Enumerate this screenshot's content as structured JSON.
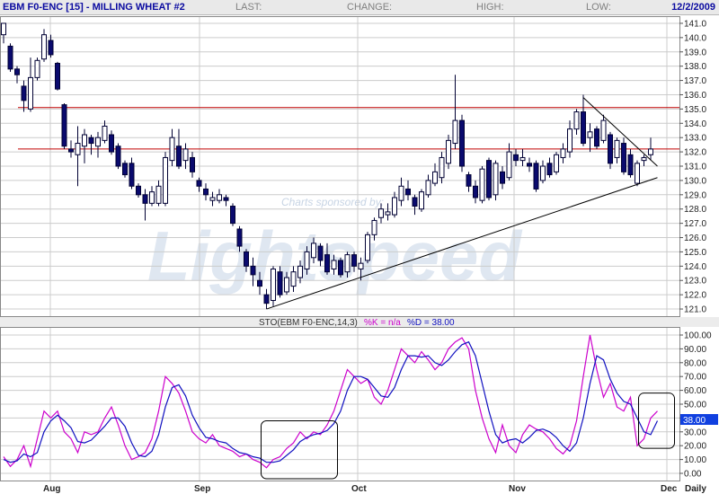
{
  "header": {
    "title": "EBM F0-ENC [15] - MILLING WHEAT #2",
    "last_label": "LAST:",
    "change_label": "CHANGE:",
    "high_label": "HIGH:",
    "low_label": "LOW:",
    "date": "12/2/2009"
  },
  "watermark": {
    "sponsor_text": "Charts sponsored by:",
    "logo_text": "Lightspeed"
  },
  "colors": {
    "up_candle_fill": "#ffffff",
    "down_candle_fill": "#0a0a6e",
    "candle_outline": "#000033",
    "resistance_line": "#c00000",
    "trend_line": "#000000",
    "k_line": "#cc00cc",
    "d_line": "#1010c0",
    "last_value_box": "#1040e0",
    "grid": "#cccccc"
  },
  "chart_data": [
    {
      "type": "candlestick",
      "y_ticks": [
        "141.0",
        "140.0",
        "139.0",
        "138.0",
        "137.0",
        "136.0",
        "135.0",
        "134.0",
        "133.0",
        "132.0",
        "131.0",
        "130.0",
        "129.0",
        "128.0",
        "127.0",
        "126.0",
        "125.0",
        "124.0",
        "123.0",
        "122.0",
        "121.0"
      ],
      "ylim": [
        120.5,
        141.5
      ],
      "grid": true,
      "x_labels": [
        "Aug",
        "Sep",
        "Oct",
        "Nov",
        "Dec",
        "Daily"
      ],
      "candles": [
        {
          "o": 140.2,
          "h": 140.8,
          "l": 139.6,
          "c": 141.0
        },
        {
          "o": 139.4,
          "h": 139.6,
          "l": 137.6,
          "c": 137.8
        },
        {
          "o": 137.8,
          "h": 138.0,
          "l": 136.8,
          "c": 137.4
        },
        {
          "o": 136.6,
          "h": 137.0,
          "l": 134.8,
          "c": 135.6
        },
        {
          "o": 135.0,
          "h": 138.6,
          "l": 134.8,
          "c": 137.2
        },
        {
          "o": 137.2,
          "h": 138.6,
          "l": 137.0,
          "c": 138.4
        },
        {
          "o": 138.5,
          "h": 140.6,
          "l": 138.3,
          "c": 140.2
        },
        {
          "o": 139.8,
          "h": 140.2,
          "l": 138.6,
          "c": 138.8
        },
        {
          "o": 138.2,
          "h": 138.3,
          "l": 136.3,
          "c": 136.4
        },
        {
          "o": 135.3,
          "h": 135.4,
          "l": 132.2,
          "c": 132.4
        },
        {
          "o": 132.2,
          "h": 132.8,
          "l": 131.6,
          "c": 132.0
        },
        {
          "o": 131.8,
          "h": 133.8,
          "l": 129.6,
          "c": 132.6
        },
        {
          "o": 132.4,
          "h": 133.6,
          "l": 131.2,
          "c": 133.2
        },
        {
          "o": 133.0,
          "h": 133.2,
          "l": 131.8,
          "c": 132.6
        },
        {
          "o": 132.4,
          "h": 133.4,
          "l": 131.6,
          "c": 133.0
        },
        {
          "o": 132.8,
          "h": 134.2,
          "l": 132.6,
          "c": 133.8
        },
        {
          "o": 133.2,
          "h": 133.5,
          "l": 131.8,
          "c": 132.0
        },
        {
          "o": 132.4,
          "h": 132.6,
          "l": 130.8,
          "c": 131.0
        },
        {
          "o": 131.2,
          "h": 131.4,
          "l": 130.2,
          "c": 130.4
        },
        {
          "o": 131.2,
          "h": 131.6,
          "l": 129.4,
          "c": 129.6
        },
        {
          "o": 129.6,
          "h": 129.8,
          "l": 128.8,
          "c": 129.0
        },
        {
          "o": 129.0,
          "h": 129.4,
          "l": 127.2,
          "c": 128.4
        },
        {
          "o": 128.4,
          "h": 129.6,
          "l": 128.2,
          "c": 129.2
        },
        {
          "o": 128.4,
          "h": 130.0,
          "l": 128.2,
          "c": 129.6
        },
        {
          "o": 128.4,
          "h": 132.0,
          "l": 128.2,
          "c": 131.6
        },
        {
          "o": 131.4,
          "h": 133.6,
          "l": 131.0,
          "c": 133.0
        },
        {
          "o": 132.4,
          "h": 133.6,
          "l": 130.8,
          "c": 131.0
        },
        {
          "o": 131.4,
          "h": 132.6,
          "l": 130.8,
          "c": 132.2
        },
        {
          "o": 131.6,
          "h": 132.0,
          "l": 130.2,
          "c": 130.6
        },
        {
          "o": 130.0,
          "h": 130.2,
          "l": 129.2,
          "c": 129.6
        },
        {
          "o": 129.4,
          "h": 129.8,
          "l": 128.6,
          "c": 129.0
        },
        {
          "o": 128.6,
          "h": 129.2,
          "l": 128.2,
          "c": 128.8
        },
        {
          "o": 128.6,
          "h": 129.4,
          "l": 128.4,
          "c": 129.0
        },
        {
          "o": 128.8,
          "h": 129.0,
          "l": 128.2,
          "c": 128.6
        },
        {
          "o": 128.2,
          "h": 128.4,
          "l": 126.8,
          "c": 127.0
        },
        {
          "o": 126.6,
          "h": 126.8,
          "l": 125.0,
          "c": 125.4
        },
        {
          "o": 125.0,
          "h": 125.2,
          "l": 123.6,
          "c": 124.0
        },
        {
          "o": 124.0,
          "h": 124.6,
          "l": 122.6,
          "c": 123.4
        },
        {
          "o": 123.0,
          "h": 123.6,
          "l": 122.0,
          "c": 122.6
        },
        {
          "o": 122.0,
          "h": 122.4,
          "l": 121.0,
          "c": 121.4
        },
        {
          "o": 121.6,
          "h": 124.0,
          "l": 121.2,
          "c": 123.8
        },
        {
          "o": 123.6,
          "h": 124.0,
          "l": 121.8,
          "c": 122.0
        },
        {
          "o": 122.2,
          "h": 123.6,
          "l": 122.0,
          "c": 123.2
        },
        {
          "o": 122.6,
          "h": 124.0,
          "l": 122.2,
          "c": 123.6
        },
        {
          "o": 123.2,
          "h": 124.4,
          "l": 122.8,
          "c": 124.0
        },
        {
          "o": 123.8,
          "h": 125.4,
          "l": 123.4,
          "c": 125.0
        },
        {
          "o": 124.6,
          "h": 126.0,
          "l": 124.2,
          "c": 125.6
        },
        {
          "o": 125.4,
          "h": 125.6,
          "l": 124.0,
          "c": 124.4
        },
        {
          "o": 124.8,
          "h": 125.6,
          "l": 123.4,
          "c": 123.6
        },
        {
          "o": 123.8,
          "h": 124.8,
          "l": 123.4,
          "c": 124.4
        },
        {
          "o": 124.4,
          "h": 124.6,
          "l": 123.2,
          "c": 123.4
        },
        {
          "o": 123.6,
          "h": 125.0,
          "l": 123.2,
          "c": 124.8
        },
        {
          "o": 124.8,
          "h": 125.0,
          "l": 123.6,
          "c": 124.0
        },
        {
          "o": 123.8,
          "h": 124.6,
          "l": 123.0,
          "c": 124.2
        },
        {
          "o": 124.4,
          "h": 126.4,
          "l": 124.2,
          "c": 126.2
        },
        {
          "o": 126.2,
          "h": 127.4,
          "l": 125.8,
          "c": 127.2
        },
        {
          "o": 127.4,
          "h": 128.4,
          "l": 127.0,
          "c": 128.0
        },
        {
          "o": 127.6,
          "h": 128.4,
          "l": 127.2,
          "c": 127.8
        },
        {
          "o": 127.6,
          "h": 129.2,
          "l": 127.4,
          "c": 128.8
        },
        {
          "o": 128.6,
          "h": 130.2,
          "l": 128.2,
          "c": 129.6
        },
        {
          "o": 129.4,
          "h": 130.0,
          "l": 128.6,
          "c": 129.0
        },
        {
          "o": 128.8,
          "h": 129.0,
          "l": 127.6,
          "c": 128.2
        },
        {
          "o": 128.0,
          "h": 129.4,
          "l": 127.8,
          "c": 129.2
        },
        {
          "o": 129.0,
          "h": 130.4,
          "l": 128.8,
          "c": 130.0
        },
        {
          "o": 129.8,
          "h": 131.2,
          "l": 129.6,
          "c": 130.6
        },
        {
          "o": 130.2,
          "h": 132.0,
          "l": 129.8,
          "c": 131.6
        },
        {
          "o": 131.2,
          "h": 133.2,
          "l": 130.8,
          "c": 132.8
        },
        {
          "o": 132.6,
          "h": 137.4,
          "l": 132.2,
          "c": 134.2
        },
        {
          "o": 134.2,
          "h": 134.6,
          "l": 130.6,
          "c": 131.0
        },
        {
          "o": 130.4,
          "h": 130.6,
          "l": 129.2,
          "c": 129.6
        },
        {
          "o": 129.6,
          "h": 130.0,
          "l": 128.4,
          "c": 128.8
        },
        {
          "o": 128.6,
          "h": 131.0,
          "l": 128.4,
          "c": 130.8
        },
        {
          "o": 131.4,
          "h": 131.6,
          "l": 128.6,
          "c": 128.8
        },
        {
          "o": 129.0,
          "h": 131.4,
          "l": 128.6,
          "c": 131.2
        },
        {
          "o": 130.6,
          "h": 131.0,
          "l": 129.4,
          "c": 129.8
        },
        {
          "o": 130.2,
          "h": 132.6,
          "l": 130.0,
          "c": 132.0
        },
        {
          "o": 131.8,
          "h": 132.2,
          "l": 131.0,
          "c": 131.4
        },
        {
          "o": 131.4,
          "h": 132.2,
          "l": 131.0,
          "c": 131.6
        },
        {
          "o": 131.2,
          "h": 131.6,
          "l": 130.6,
          "c": 131.0
        },
        {
          "o": 131.2,
          "h": 131.4,
          "l": 129.2,
          "c": 129.4
        },
        {
          "o": 130.0,
          "h": 131.4,
          "l": 129.8,
          "c": 131.0
        },
        {
          "o": 131.2,
          "h": 131.6,
          "l": 130.2,
          "c": 130.4
        },
        {
          "o": 130.6,
          "h": 132.0,
          "l": 130.4,
          "c": 131.8
        },
        {
          "o": 131.6,
          "h": 132.6,
          "l": 131.2,
          "c": 132.2
        },
        {
          "o": 132.0,
          "h": 134.2,
          "l": 131.6,
          "c": 133.6
        },
        {
          "o": 133.6,
          "h": 135.0,
          "l": 133.2,
          "c": 134.8
        },
        {
          "o": 134.8,
          "h": 136.0,
          "l": 132.4,
          "c": 132.6
        },
        {
          "o": 133.0,
          "h": 134.0,
          "l": 132.0,
          "c": 133.4
        },
        {
          "o": 133.6,
          "h": 133.8,
          "l": 132.2,
          "c": 132.4
        },
        {
          "o": 132.8,
          "h": 134.6,
          "l": 132.6,
          "c": 134.2
        },
        {
          "o": 133.2,
          "h": 133.4,
          "l": 130.8,
          "c": 131.2
        },
        {
          "o": 131.6,
          "h": 133.0,
          "l": 131.2,
          "c": 132.8
        },
        {
          "o": 132.6,
          "h": 133.0,
          "l": 130.4,
          "c": 130.6
        },
        {
          "o": 131.8,
          "h": 132.2,
          "l": 130.2,
          "c": 130.4
        },
        {
          "o": 129.8,
          "h": 131.4,
          "l": 129.6,
          "c": 131.2
        },
        {
          "o": 131.4,
          "h": 131.8,
          "l": 131.0,
          "c": 131.6
        },
        {
          "o": 131.8,
          "h": 133.0,
          "l": 131.4,
          "c": 132.2
        }
      ],
      "resistance_levels": [
        135.1,
        132.2
      ],
      "trendlines": [
        {
          "from": [
            39,
            121.0
          ],
          "to": [
            97,
            130.2
          ]
        },
        {
          "from": [
            86,
            135.8
          ],
          "to": [
            97,
            131.0
          ]
        }
      ]
    },
    {
      "type": "line",
      "title": "STO(EBM F0-ENC,14,3)",
      "k_label": "%K = n/a",
      "d_label": "%D = 38.00",
      "last_value": "38.00",
      "y_ticks": [
        "100.00",
        "90.00",
        "80.00",
        "70.00",
        "60.00",
        "50.00",
        "40.00",
        "30.00",
        "20.00",
        "10.00",
        "0.00"
      ],
      "ylim": [
        0,
        100
      ],
      "grid": true,
      "series": [
        {
          "name": "%K",
          "values": [
            12,
            5,
            10,
            20,
            5,
            25,
            45,
            40,
            45,
            30,
            25,
            15,
            30,
            28,
            30,
            40,
            48,
            35,
            20,
            10,
            12,
            15,
            25,
            45,
            70,
            65,
            58,
            45,
            30,
            25,
            22,
            28,
            20,
            18,
            16,
            12,
            14,
            10,
            8,
            4,
            10,
            12,
            18,
            22,
            30,
            25,
            30,
            28,
            35,
            45,
            60,
            75,
            70,
            65,
            68,
            55,
            50,
            60,
            75,
            90,
            85,
            80,
            88,
            82,
            75,
            80,
            90,
            95,
            98,
            90,
            60,
            40,
            25,
            15,
            35,
            20,
            15,
            28,
            35,
            32,
            30,
            25,
            18,
            14,
            20,
            38,
            70,
            100,
            75,
            55,
            65,
            48,
            45,
            55,
            20,
            25,
            40,
            45
          ]
        },
        {
          "name": "%D",
          "values": [
            10,
            8,
            9,
            14,
            12,
            15,
            30,
            38,
            42,
            38,
            33,
            23,
            22,
            24,
            29,
            34,
            40,
            40,
            34,
            22,
            13,
            12,
            16,
            28,
            48,
            62,
            64,
            56,
            42,
            33,
            26,
            25,
            23,
            22,
            18,
            15,
            14,
            12,
            11,
            8,
            8,
            9,
            13,
            17,
            23,
            26,
            28,
            29,
            31,
            36,
            45,
            60,
            70,
            70,
            68,
            62,
            56,
            55,
            62,
            75,
            85,
            85,
            84,
            85,
            80,
            78,
            82,
            88,
            93,
            95,
            85,
            65,
            45,
            28,
            22,
            24,
            25,
            22,
            26,
            31,
            32,
            30,
            26,
            20,
            16,
            22,
            40,
            65,
            85,
            82,
            68,
            58,
            52,
            50,
            40,
            30,
            28,
            38
          ]
        }
      ],
      "annotation_boxes": [
        {
          "x_from": 39,
          "x_to": 49,
          "y_from": 0,
          "y_to": 38
        },
        {
          "x_from": 95,
          "x_to": 99,
          "y_from": 22,
          "y_to": 58
        }
      ]
    }
  ]
}
